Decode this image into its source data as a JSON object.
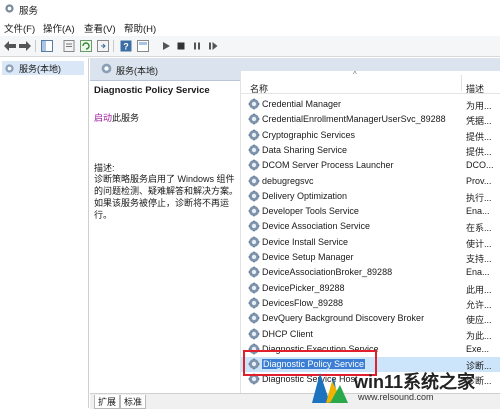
{
  "window": {
    "title": "服务"
  },
  "menu": {
    "file": "文件(F)",
    "action": "操作(A)",
    "view": "查看(V)",
    "help": "帮助(H)"
  },
  "tree": {
    "root": "服务(本地)"
  },
  "pane_header": {
    "title": "服务(本地)"
  },
  "detail": {
    "service_name": "Diagnostic Policy Service",
    "start_link": "启动",
    "start_suffix": "此服务",
    "desc_label": "描述:",
    "desc_text": "诊断策略服务启用了 Windows 组件的问题检测、疑难解答和解决方案。如果该服务被停止，诊断将不再运行。"
  },
  "columns": {
    "name": "名称",
    "description": "描述"
  },
  "services": [
    {
      "name": "Credential Manager",
      "desc": "为用..."
    },
    {
      "name": "CredentialEnrollmentManagerUserSvc_89288",
      "desc": "凭据..."
    },
    {
      "name": "Cryptographic Services",
      "desc": "提供..."
    },
    {
      "name": "Data Sharing Service",
      "desc": "提供..."
    },
    {
      "name": "DCOM Server Process Launcher",
      "desc": "DCO..."
    },
    {
      "name": "debugregsvc",
      "desc": "Prov..."
    },
    {
      "name": "Delivery Optimization",
      "desc": "执行..."
    },
    {
      "name": "Developer Tools Service",
      "desc": "Ena..."
    },
    {
      "name": "Device Association Service",
      "desc": "在系..."
    },
    {
      "name": "Device Install Service",
      "desc": "使计..."
    },
    {
      "name": "Device Setup Manager",
      "desc": "支持..."
    },
    {
      "name": "DeviceAssociationBroker_89288",
      "desc": "Ena..."
    },
    {
      "name": "DevicePicker_89288",
      "desc": "此用..."
    },
    {
      "name": "DevicesFlow_89288",
      "desc": "允许..."
    },
    {
      "name": "DevQuery Background Discovery Broker",
      "desc": "使应..."
    },
    {
      "name": "DHCP Client",
      "desc": "为此..."
    },
    {
      "name": "Diagnostic Execution Service",
      "desc": "Exe..."
    },
    {
      "name": "Diagnostic Policy Service",
      "desc": "诊断..."
    },
    {
      "name": "Diagnostic Service Host",
      "desc": "诊断..."
    }
  ],
  "tabs": {
    "extended": "扩展",
    "standard": "标准"
  },
  "watermark": {
    "text": "win11系统之家",
    "url": "www.relsound.com"
  },
  "colors": {
    "selection": "#3b7ed3",
    "header": "#dbe4ee",
    "highlight": "#e0202c",
    "link": "#9a1a9a"
  }
}
